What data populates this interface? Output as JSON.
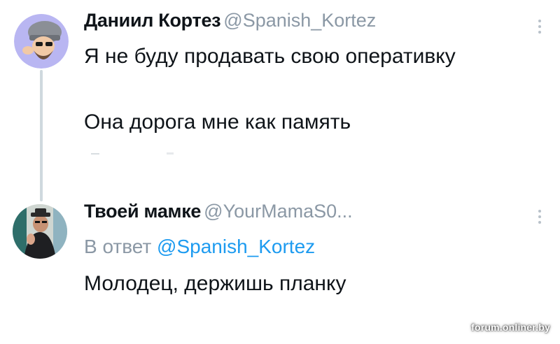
{
  "tweets": [
    {
      "display_name": "Даниил Кортез",
      "handle": "@Spanish_Kortez",
      "lines": [
        "Я не буду продавать свою оперативку",
        "Она дорога мне как память"
      ]
    },
    {
      "display_name": "Твоей мамке",
      "handle": "@YourMamaS0...",
      "reply_prefix": "В ответ",
      "reply_mention": "@Spanish_Kortez",
      "lines": [
        "Молодец, держишь планку"
      ]
    }
  ],
  "watermark": "forum.onliner.by",
  "icons": {
    "avatar_1": "cartoon-bearded-man-with-hat-icon",
    "avatar_2": "man-pointing-photo-icon",
    "more": "vertical-ellipsis-icon"
  },
  "colors": {
    "text": "#0f1419",
    "secondary": "#8b98a5",
    "mention": "#1d9bf0",
    "thread_line": "#cfd9de"
  }
}
